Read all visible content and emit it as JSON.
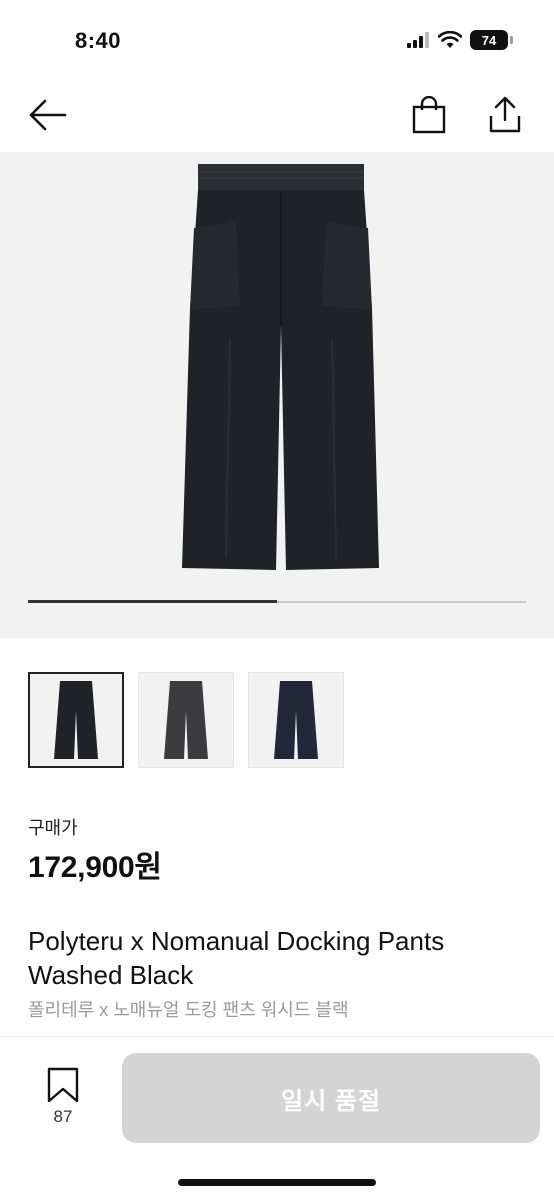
{
  "status_bar": {
    "time": "8:40",
    "battery": "74"
  },
  "product": {
    "price_label": "구매가",
    "price": "172,900원",
    "title_en": "Polyteru x Nomanual Docking Pants Washed Black",
    "title_ko": "폴리테루 x 노매뉴얼 도킹 팬츠 워시드 블랙",
    "colors": [
      "#1f2227",
      "#3c3c3f",
      "#23273a"
    ]
  },
  "gallery": {
    "progress": 0.5
  },
  "actions": {
    "wish_count": "87",
    "buy_label": "일시 품절"
  },
  "icons": [
    "back-arrow-icon",
    "shopping-bag-icon",
    "share-icon",
    "bookmark-icon"
  ]
}
